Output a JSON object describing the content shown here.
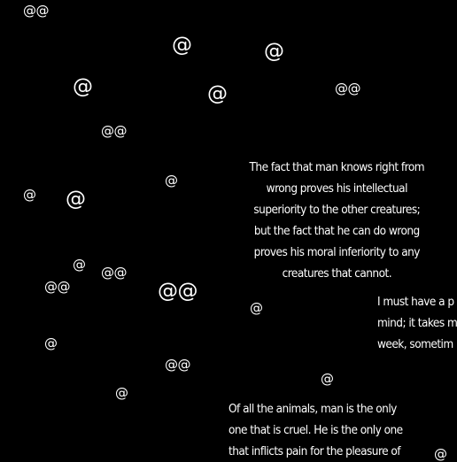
{
  "background": "#000000",
  "text_color": "#ffffff",
  "symbols": [
    "@@",
    "@",
    "@",
    "@",
    "@",
    "@@",
    "@@",
    "@",
    "@",
    "@",
    "@",
    "@@",
    "@@",
    "@@",
    "@",
    "@",
    "@@",
    "@",
    "@",
    "@"
  ],
  "quotes": [
    {
      "lines": [
        "The fact that man knows right from",
        "wrong proves his intellectual",
        "superiority to the other creatures;",
        "but the fact that he can do wrong",
        "proves his moral inferiority to any",
        "creatures that cannot."
      ]
    },
    {
      "lines": [
        "I must have a p",
        "mind; it takes m",
        "week, sometim"
      ]
    },
    {
      "lines": [
        "Of all the animals, man is the only",
        "one that is cruel. He is the only one",
        "that inflicts pain for the pleasure of"
      ]
    }
  ]
}
